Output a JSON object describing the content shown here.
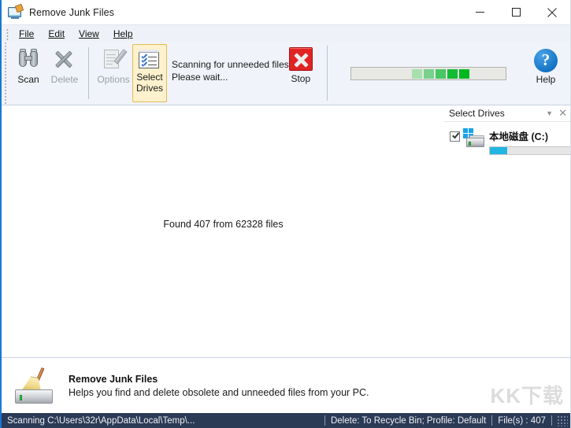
{
  "window": {
    "title": "Remove Junk Files",
    "icon": "app-screen-brush-icon",
    "minimize_label": "minimize",
    "maximize_label": "maximize",
    "close_label": "close"
  },
  "menu": {
    "items": [
      {
        "label": "File"
      },
      {
        "label": "Edit"
      },
      {
        "label": "View"
      },
      {
        "label": "Help"
      }
    ]
  },
  "toolbar": {
    "scan_label": "Scan",
    "delete_label": "Delete",
    "options_label": "Options",
    "select_drives_label_1": "Select",
    "select_drives_label_2": "Drives",
    "status_line_1": "Scanning for unneeded files",
    "status_line_2": "Please wait...",
    "stop_label": "Stop",
    "help_label": "Help",
    "help_glyph": "?",
    "progress": {
      "style": "marquee",
      "block_count": 5,
      "colors": [
        "#a7e0ae",
        "#79d18c",
        "#4ac765",
        "#14bb34",
        "#00b81f"
      ],
      "track_color": "#e8e8e4"
    },
    "accent_selected_bg": "#fdf2cd",
    "accent_selected_border": "#e2bb55",
    "stop_color": "#e02424",
    "help_color": "#1574c4"
  },
  "main": {
    "found_text": "Found 407 from 62328 files"
  },
  "drives_panel": {
    "title": "Select Drives",
    "collapse_icon": "chevron-down-icon",
    "close_icon": "close-icon",
    "drives": [
      {
        "label": "本地磁盘 (C:)",
        "checked": true,
        "usage_percent": 22,
        "usage_color": "#21b5e0"
      }
    ]
  },
  "info_panel": {
    "icon": "broom-disk-icon",
    "title": "Remove Junk Files",
    "description": "Helps you find and delete obsolete and unneeded files from your PC."
  },
  "watermark": {
    "text": "KK下载"
  },
  "statusbar": {
    "scanning_path": "Scanning C:\\Users\\32r\\AppData\\Local\\Temp\\...",
    "delete_profile": "Delete: To Recycle Bin; Profile: Default",
    "file_count": "File(s) : 407",
    "background": "#2b3a55"
  }
}
